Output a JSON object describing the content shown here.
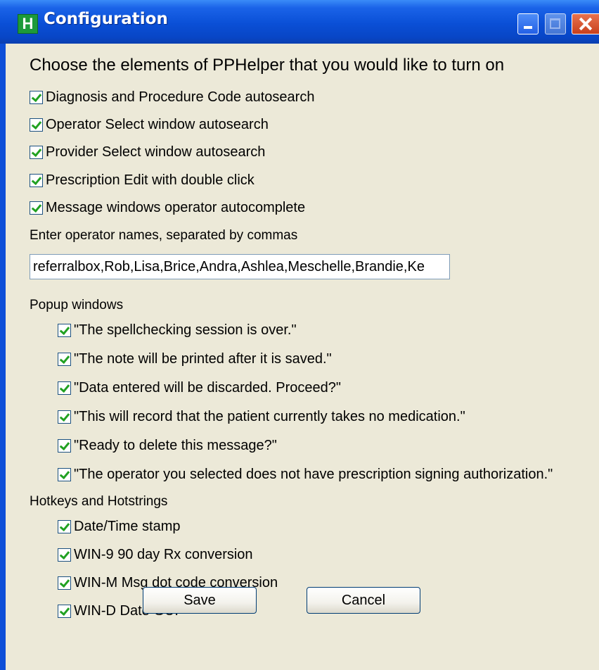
{
  "window": {
    "title": "Configuration",
    "icon_letter": "H"
  },
  "heading": "Choose the elements of PPHelper that you would like to turn on",
  "main_options": [
    {
      "label": "Diagnosis and Procedure Code autosearch",
      "checked": true
    },
    {
      "label": "Operator Select window autosearch",
      "checked": true
    },
    {
      "label": "Provider Select window autosearch",
      "checked": true
    },
    {
      "label": "Prescription Edit with double click",
      "checked": true
    },
    {
      "label": "Message windows operator autocomplete",
      "checked": true
    }
  ],
  "operator_names": {
    "label": "Enter operator names, separated by commas",
    "value": "referralbox,Rob,Lisa,Brice,Andra,Ashlea,Meschelle,Brandie,Ke"
  },
  "popup_windows": {
    "label": "Popup windows",
    "items": [
      {
        "label": "\"The spellchecking session is over.\"",
        "checked": true
      },
      {
        "label": "\"The note will be printed after it is saved.\"",
        "checked": true
      },
      {
        "label": "\"Data entered will be discarded.  Proceed?\"",
        "checked": true
      },
      {
        "label": "\"This will record that the patient currently takes no medication.\"",
        "checked": true
      },
      {
        "label": "\"Ready to delete this message?\"",
        "checked": true
      },
      {
        "label": "\"The operator you selected does not have prescription signing authorization.\"",
        "checked": true
      }
    ]
  },
  "hotkeys": {
    "label": "Hotkeys and Hotstrings",
    "items": [
      {
        "label": "Date/Time stamp",
        "checked": true
      },
      {
        "label": "WIN-9 90 day Rx conversion",
        "checked": true
      },
      {
        "label": "WIN-M Msg dot code conversion",
        "checked": true
      },
      {
        "label": "WIN-D Date GUI",
        "checked": true
      }
    ]
  },
  "buttons": {
    "save": "Save",
    "cancel": "Cancel"
  }
}
